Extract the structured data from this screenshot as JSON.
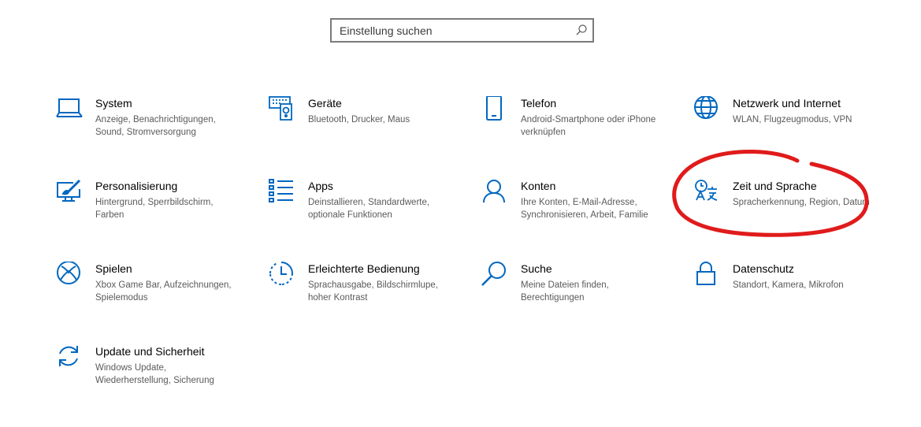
{
  "search": {
    "placeholder": "Einstellung suchen"
  },
  "accent_color": "#0067c0",
  "annotation_color": "#e01b1b",
  "tiles": [
    {
      "title": "System",
      "desc": "Anzeige, Benachrichtigungen, Sound, Stromversorgung",
      "icon": "laptop-icon"
    },
    {
      "title": "Geräte",
      "desc": "Bluetooth, Drucker, Maus",
      "icon": "devices-icon"
    },
    {
      "title": "Telefon",
      "desc": "Android-Smartphone oder iPhone verknüpfen",
      "icon": "phone-icon"
    },
    {
      "title": "Netzwerk und Internet",
      "desc": "WLAN, Flugzeugmodus, VPN",
      "icon": "globe-icon"
    },
    {
      "title": "Personalisierung",
      "desc": "Hintergrund, Sperrbildschirm, Farben",
      "icon": "paint-icon"
    },
    {
      "title": "Apps",
      "desc": "Deinstallieren, Standardwerte, optionale Funktionen",
      "icon": "apps-list-icon"
    },
    {
      "title": "Konten",
      "desc": "Ihre Konten, E-Mail-Adresse, Synchronisieren, Arbeit, Familie",
      "icon": "person-icon"
    },
    {
      "title": "Zeit und Sprache",
      "desc": "Spracherkennung, Region, Datum",
      "icon": "time-language-icon"
    },
    {
      "title": "Spielen",
      "desc": "Xbox Game Bar, Aufzeichnungen, Spielemodus",
      "icon": "xbox-icon"
    },
    {
      "title": "Erleichterte Bedienung",
      "desc": "Sprachausgabe, Bildschirmlupe, hoher Kontrast",
      "icon": "ease-of-access-icon"
    },
    {
      "title": "Suche",
      "desc": "Meine Dateien finden, Berechtigungen",
      "icon": "search-magnifier-icon"
    },
    {
      "title": "Datenschutz",
      "desc": "Standort, Kamera, Mikrofon",
      "icon": "lock-icon"
    },
    {
      "title": "Update und Sicherheit",
      "desc": "Windows Update, Wiederherstellung, Sicherung",
      "icon": "sync-icon"
    }
  ]
}
